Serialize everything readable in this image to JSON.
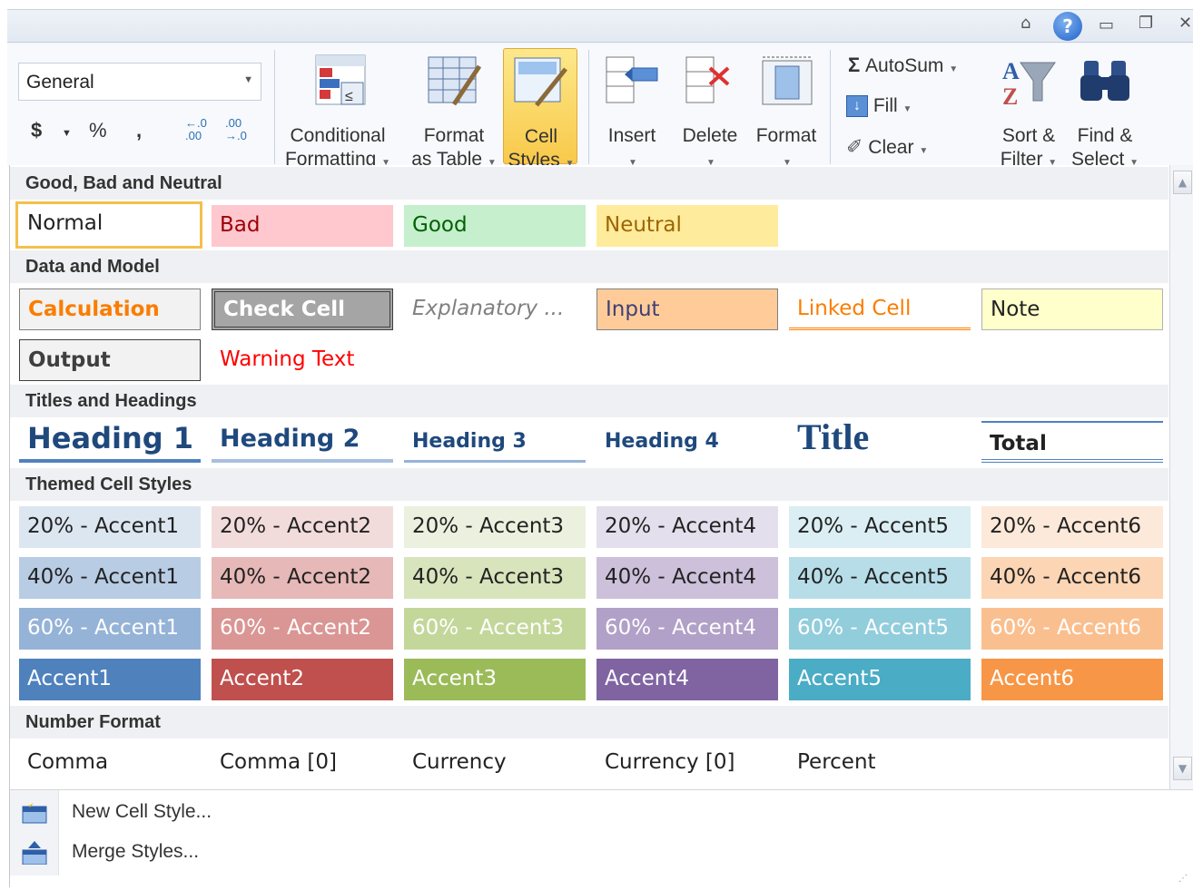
{
  "ribbon": {
    "number_format": "General",
    "currency_symbol": "$",
    "percent_symbol": "%",
    "comma_symbol": ",",
    "increase_decimal": "←.0\n.00",
    "decrease_decimal": ".00\n→.0",
    "conditional_formatting": [
      "Conditional",
      "Formatting"
    ],
    "format_as_table": [
      "Format",
      "as Table"
    ],
    "cell_styles": [
      "Cell",
      "Styles"
    ],
    "insert": "Insert",
    "delete": "Delete",
    "format": "Format",
    "autosum": "AutoSum",
    "fill": "Fill",
    "clear": "Clear",
    "sort_filter": [
      "Sort &",
      "Filter"
    ],
    "find_select": [
      "Find &",
      "Select"
    ]
  },
  "gallery": {
    "sections": {
      "good_bad_neutral": "Good, Bad and Neutral",
      "data_model": "Data and Model",
      "titles_headings": "Titles and Headings",
      "themed": "Themed Cell Styles",
      "number_format": "Number Format"
    },
    "good_bad_neutral": [
      "Normal",
      "Bad",
      "Good",
      "Neutral"
    ],
    "data_model": [
      "Calculation",
      "Check Cell",
      "Explanatory ...",
      "Input",
      "Linked Cell",
      "Note",
      "Output",
      "Warning Text"
    ],
    "titles_headings": [
      "Heading 1",
      "Heading 2",
      "Heading 3",
      "Heading 4",
      "Title",
      "Total"
    ],
    "themed_20": [
      "20% - Accent1",
      "20% - Accent2",
      "20% - Accent3",
      "20% - Accent4",
      "20% - Accent5",
      "20% - Accent6"
    ],
    "themed_40": [
      "40% - Accent1",
      "40% - Accent2",
      "40% - Accent3",
      "40% - Accent4",
      "40% - Accent5",
      "40% - Accent6"
    ],
    "themed_60": [
      "60% - Accent1",
      "60% - Accent2",
      "60% - Accent3",
      "60% - Accent4",
      "60% - Accent5",
      "60% - Accent6"
    ],
    "themed_100": [
      "Accent1",
      "Accent2",
      "Accent3",
      "Accent4",
      "Accent5",
      "Accent6"
    ],
    "number_format": [
      "Comma",
      "Comma [0]",
      "Currency",
      "Currency [0]",
      "Percent"
    ]
  },
  "footer": {
    "new_cell_style": "New Cell Style...",
    "merge_styles": "Merge Styles..."
  },
  "colors": {
    "accent1": "#4f81bd",
    "accent2": "#c0504d",
    "accent3": "#9bbb59",
    "accent4": "#8064a2",
    "accent5": "#4bacc6",
    "accent6": "#f79646",
    "selected_highlight": "#f8c94a"
  },
  "icons": {
    "minimize_ribbon": "chevron-up-icon",
    "help": "help-icon",
    "window_restore": "window-restore-icon",
    "autosum": "sigma-icon"
  }
}
